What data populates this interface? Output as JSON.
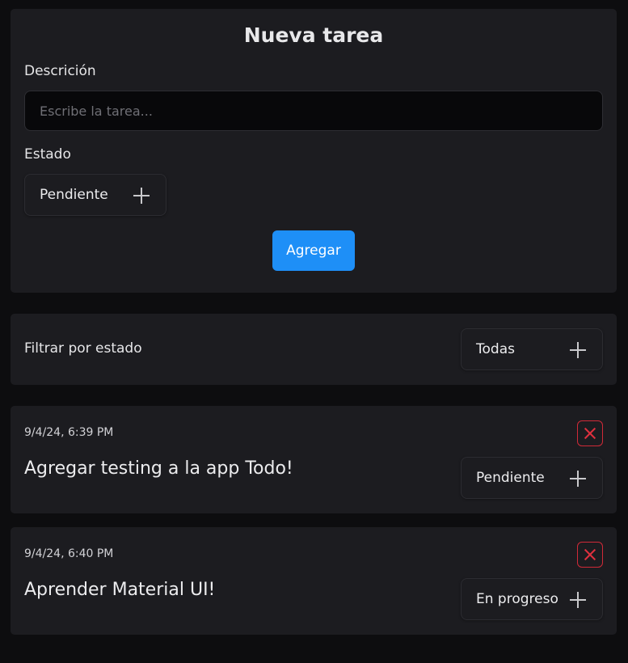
{
  "form": {
    "title": "Nueva tarea",
    "description_label": "Descrición",
    "description_placeholder": "Escribe la tarea...",
    "description_value": "",
    "status_label": "Estado",
    "status_selected": "Pendiente",
    "submit_label": "Agregar"
  },
  "filter": {
    "label": "Filtrar por estado",
    "selected": "Todas"
  },
  "tasks": [
    {
      "date": "9/4/24, 6:39 PM",
      "text": "Agregar testing a la app Todo!",
      "status": "Pendiente"
    },
    {
      "date": "9/4/24, 6:40 PM",
      "text": "Aprender Material UI!",
      "status": "En progreso"
    }
  ],
  "icons": {
    "status_select": "plus-icon",
    "filter_select": "plus-icon",
    "delete": "close-icon"
  },
  "colors": {
    "background": "#0d0d0f",
    "card": "#1c1c20",
    "primary": "#1e8ff7",
    "danger": "#e0303e"
  }
}
